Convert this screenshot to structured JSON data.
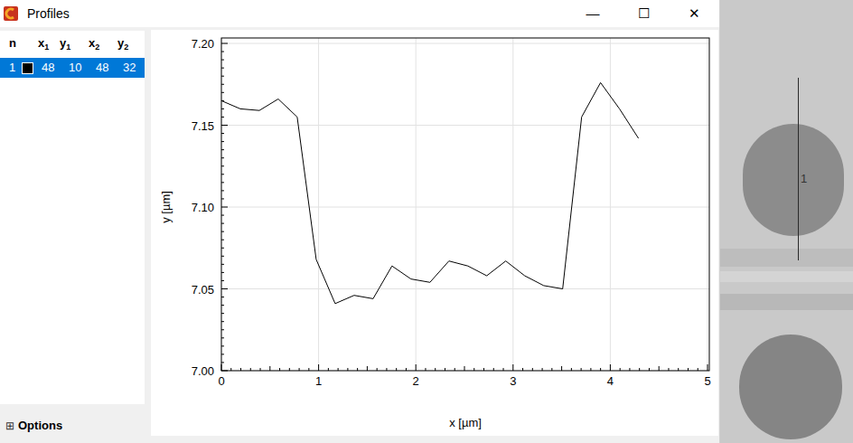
{
  "window": {
    "title": "Profiles",
    "controls": [
      "—",
      "☐",
      "✕"
    ]
  },
  "table": {
    "columns": [
      {
        "text": "n",
        "sub": ""
      },
      {
        "text": "x",
        "sub": "1"
      },
      {
        "text": "y",
        "sub": "1"
      },
      {
        "text": "x",
        "sub": "2"
      },
      {
        "text": "y",
        "sub": "2"
      }
    ],
    "rows": [
      {
        "n": "1",
        "color": "#000000",
        "x1": "48",
        "y1": "10",
        "x2": "48",
        "y2": "32",
        "selected": true
      }
    ]
  },
  "options": {
    "icon": "⊞",
    "label": "Options"
  },
  "chart": {
    "x_label": "x [µm]",
    "y_label": "y [µm]",
    "x_ticks": [
      "0",
      "1",
      "2",
      "3",
      "4",
      "5"
    ],
    "y_ticks": [
      "7.00",
      "7.05",
      "7.10",
      "7.15",
      "7.20"
    ],
    "series": [
      {
        "name": "1",
        "color": "#000000",
        "x": [
          0,
          0.195,
          0.39,
          0.585,
          0.78,
          0.975,
          1.17,
          1.365,
          1.56,
          1.755,
          1.95,
          2.145,
          2.34,
          2.535,
          2.73,
          2.925,
          3.12,
          3.315,
          3.51,
          3.705,
          3.9,
          4.095,
          4.29
        ],
        "y": [
          7.165,
          7.16,
          7.159,
          7.166,
          7.155,
          7.068,
          7.041,
          7.046,
          7.044,
          7.064,
          7.056,
          7.054,
          7.067,
          7.064,
          7.058,
          7.067,
          7.058,
          7.052,
          7.05,
          7.155,
          7.176,
          7.16,
          7.142
        ]
      }
    ]
  },
  "image": {
    "profile_label": "1"
  }
}
